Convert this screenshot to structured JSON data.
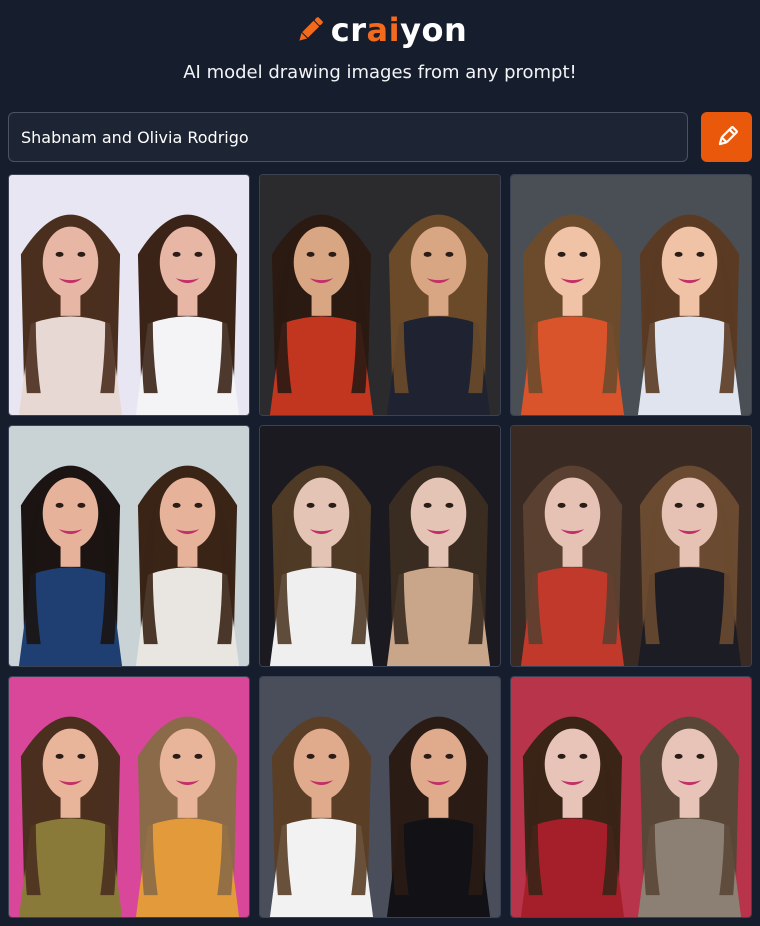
{
  "header": {
    "brand_prefix": "cr",
    "brand_highlight": "ai",
    "brand_suffix": "yon",
    "tagline": "AI model drawing images from any prompt!",
    "logo_icon": "pencil-icon"
  },
  "prompt": {
    "value": "Shabnam and Olivia Rodrigo",
    "draw_icon": "pencil-icon"
  },
  "colors": {
    "background": "#161d2d",
    "accent": "#ea580c",
    "brand_highlight": "#f26a1b"
  },
  "results": {
    "count": 9,
    "tiles": [
      {
        "bg": "#e9e6f3",
        "left_hair": "#4a2f1f",
        "right_hair": "#3b2417",
        "left_top": "#e8d8d4",
        "right_top": "#f4f4f6",
        "skin": "#e8b6a4"
      },
      {
        "bg": "#2b2b2e",
        "left_hair": "#2a1a12",
        "right_hair": "#6b4a2a",
        "left_top": "#c23620",
        "right_top": "#1f2230",
        "skin": "#d9a684"
      },
      {
        "bg": "#4a4f55",
        "left_hair": "#6b4b2c",
        "right_hair": "#5a3a22",
        "left_top": "#d9532b",
        "right_top": "#dfe4ee",
        "skin": "#f0c2a6"
      },
      {
        "bg": "#c9d3d6",
        "left_hair": "#1b1412",
        "right_hair": "#3a2416",
        "left_top": "#1f3f72",
        "right_top": "#e9e5e1",
        "skin": "#e6b29a"
      },
      {
        "bg": "#1a1a20",
        "left_hair": "#4f3a26",
        "right_hair": "#3a2c20",
        "left_top": "#f0eff0",
        "right_top": "#c9a58a",
        "skin": "#e4c4b4"
      },
      {
        "bg": "#3a2a24",
        "left_hair": "#5a4030",
        "right_hair": "#6a4a30",
        "left_top": "#c0392b",
        "right_top": "#1c1c24",
        "skin": "#e6c2b4"
      },
      {
        "bg": "#d9479a",
        "left_hair": "#4a2f1f",
        "right_hair": "#8a6a48",
        "left_top": "#8a7a3a",
        "right_top": "#e39a3a",
        "skin": "#e8b49a"
      },
      {
        "bg": "#4a4e5a",
        "left_hair": "#5a3e26",
        "right_hair": "#2a1c14",
        "left_top": "#f2f2f2",
        "right_top": "#111116",
        "skin": "#e0aa8c"
      },
      {
        "bg": "#b8344a",
        "left_hair": "#3a2416",
        "right_hair": "#5a4636",
        "left_top": "#a51f2a",
        "right_top": "#8c8074",
        "skin": "#e8c4b8"
      }
    ]
  }
}
